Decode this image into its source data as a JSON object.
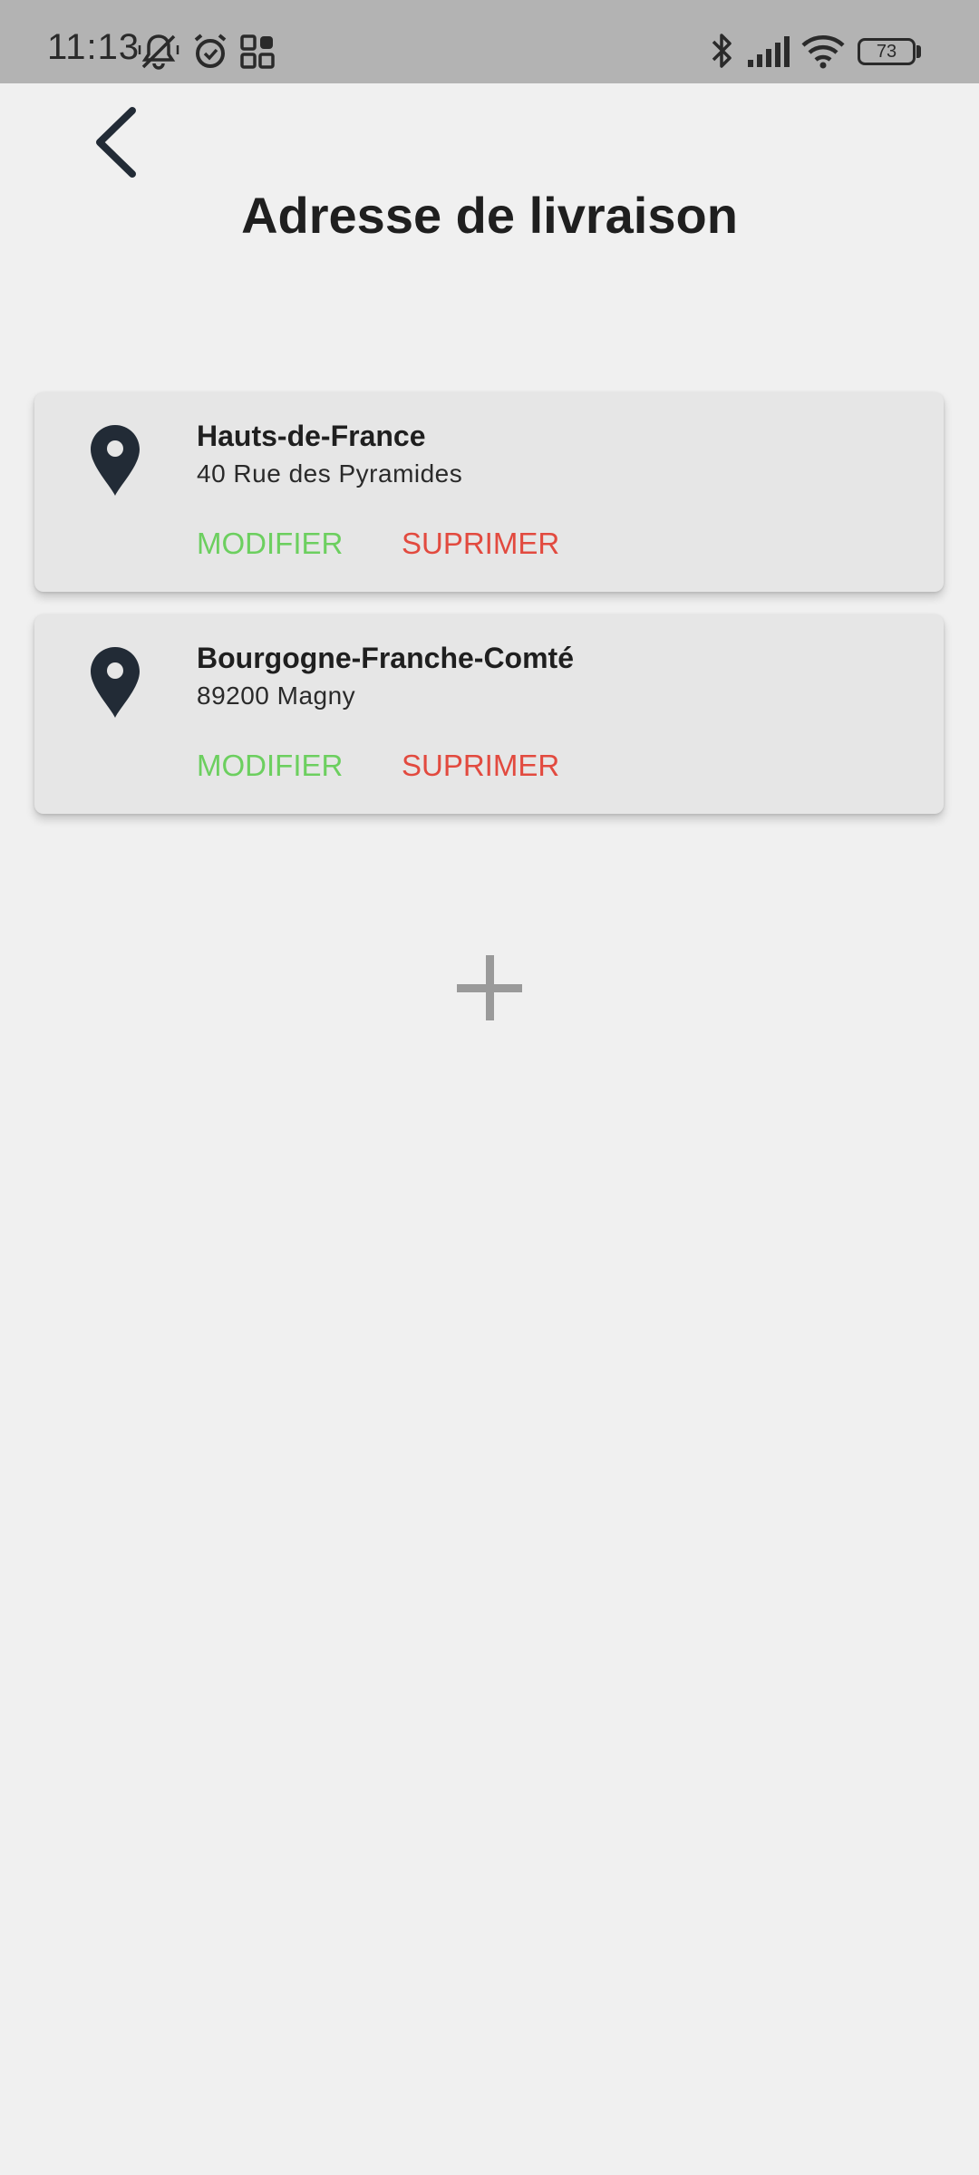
{
  "status_bar": {
    "time": "11:13",
    "left_icons": [
      "bell-muted-icon",
      "alarm-icon",
      "apps-icon"
    ],
    "right_icons": [
      "bluetooth-icon",
      "signal-icon",
      "wifi-icon"
    ],
    "battery": "73"
  },
  "header": {
    "back_icon": "chevron-left-icon",
    "title": "Adresse de livraison"
  },
  "addresses": [
    {
      "region": "Hauts-de-France",
      "address": "40 Rue des Pyramides",
      "modify_label": "MODIFIER",
      "delete_label": "SUPRIMER"
    },
    {
      "region": "Bourgogne-Franche-Comté",
      "address": "89200 Magny",
      "modify_label": "MODIFIER",
      "delete_label": "SUPRIMER"
    }
  ],
  "add_button_icon": "plus-icon",
  "colors": {
    "modify": "#6ccf5f",
    "delete": "#e24a3f",
    "pin": "#222b36",
    "background": "#f0f0f0",
    "card": "#e6e6e6"
  }
}
